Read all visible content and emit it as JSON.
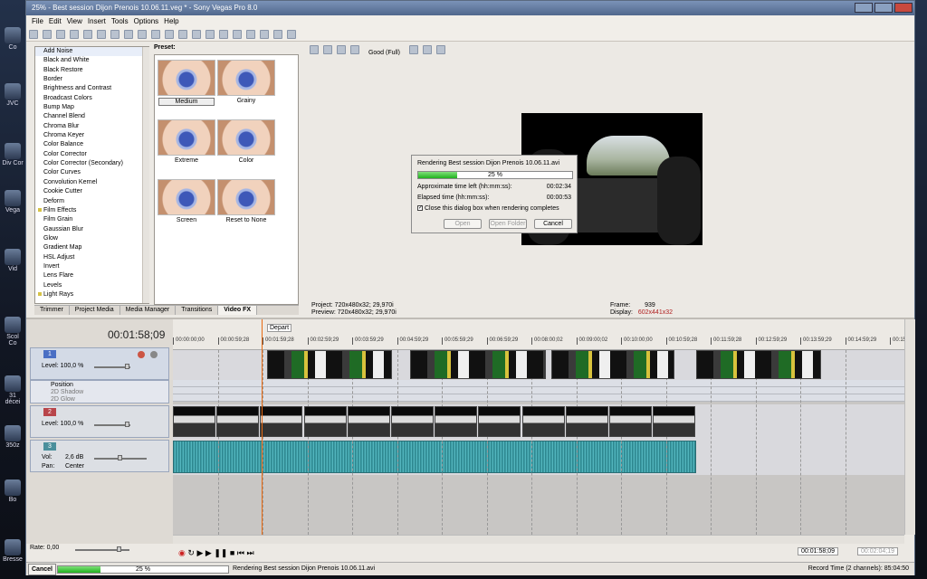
{
  "window": {
    "title": "25% - Best session Dijon Prenois 10.06.11.veg * - Sony Vegas Pro 8.0"
  },
  "desktop": {
    "icons": [
      "Co",
      "JVC",
      "Div\nCor",
      "Vega",
      "Vid",
      "Scol\nCo",
      "31 décei",
      "350z",
      "Bo",
      "Bresse"
    ]
  },
  "menu": [
    "File",
    "Edit",
    "View",
    "Insert",
    "Tools",
    "Options",
    "Help"
  ],
  "fx_list": [
    "Add Noise",
    "Black and White",
    "Black Restore",
    "Border",
    "Brightness and Contrast",
    "Broadcast Colors",
    "Bump Map",
    "Channel Blend",
    "Chroma Blur",
    "Chroma Keyer",
    "Color Balance",
    "Color Corrector",
    "Color Corrector (Secondary)",
    "Color Curves",
    "Convolution Kernel",
    "Cookie Cutter",
    "Deform",
    "Film Effects",
    "Film Grain",
    "Gaussian Blur",
    "Glow",
    "Gradient Map",
    "HSL Adjust",
    "Invert",
    "Lens Flare",
    "Levels",
    "Light Rays"
  ],
  "preset": {
    "label": "Preset:",
    "items": [
      "Medium",
      "Grainy",
      "Extreme",
      "Color",
      "Screen",
      "Reset to None"
    ]
  },
  "tabs": [
    "Trimmer",
    "Project Media",
    "Media Manager",
    "Transitions",
    "Video FX"
  ],
  "preview": {
    "quality": "Good (Full)",
    "project": "Project:  720x480x32; 29,970i",
    "preview": "Preview:  720x480x32; 29,970i",
    "frame_label": "Frame:",
    "frame": "939",
    "display_label": "Display:",
    "display": "602x441x32"
  },
  "dialog": {
    "title": "Rendering Best session Dijon Prenois 10.06.11.avi",
    "percent_text": "25 %",
    "progress": 0.25,
    "time_left_label": "Approximate time left (hh:mm:ss):",
    "time_left": "00:02:34",
    "elapsed_label": "Elapsed time (hh:mm:ss):",
    "elapsed": "00:00:53",
    "close_label": "Close this dialog box when rendering completes",
    "open": "Open",
    "open_folder": "Open Folder",
    "cancel": "Cancel"
  },
  "timeline": {
    "timecode": "00:01:58;09",
    "marker": "Depart",
    "ticks": [
      "00:00:00;00",
      "00:00:59;28",
      "00:01:59;28",
      "00:02:59;29",
      "00:03:59;29",
      "00:04:59;29",
      "00:05:59;29",
      "00:06:59;29",
      "00:08:00;02",
      "00:09:00;02",
      "00:10:00;00",
      "00:10:59;28",
      "00:11:59;28",
      "00:12:59;29",
      "00:13:59;29",
      "00:14:59;29",
      "00:15"
    ]
  },
  "tracks": {
    "t1": {
      "num": "1",
      "level": "Level: 100,0 %",
      "env": [
        "Position",
        "2D Shadow",
        "2D Glow"
      ]
    },
    "t2": {
      "num": "2",
      "level": "Level: 100,0 %"
    },
    "t3": {
      "num": "3",
      "vol_label": "Vol:",
      "vol": "2,6 dB",
      "pan_label": "Pan:",
      "pan": "Center"
    }
  },
  "transport": {
    "rate": "Rate: 0,00",
    "tc1": "00:01:58;09",
    "tc2": "00:02:04;19"
  },
  "status": {
    "cancel": "Cancel",
    "percent": "25 %",
    "progress": 0.25,
    "message": "Rendering Best session Dijon Prenois 10.06.11.avi",
    "record": "Record Time (2 channels): 85:04:50"
  }
}
